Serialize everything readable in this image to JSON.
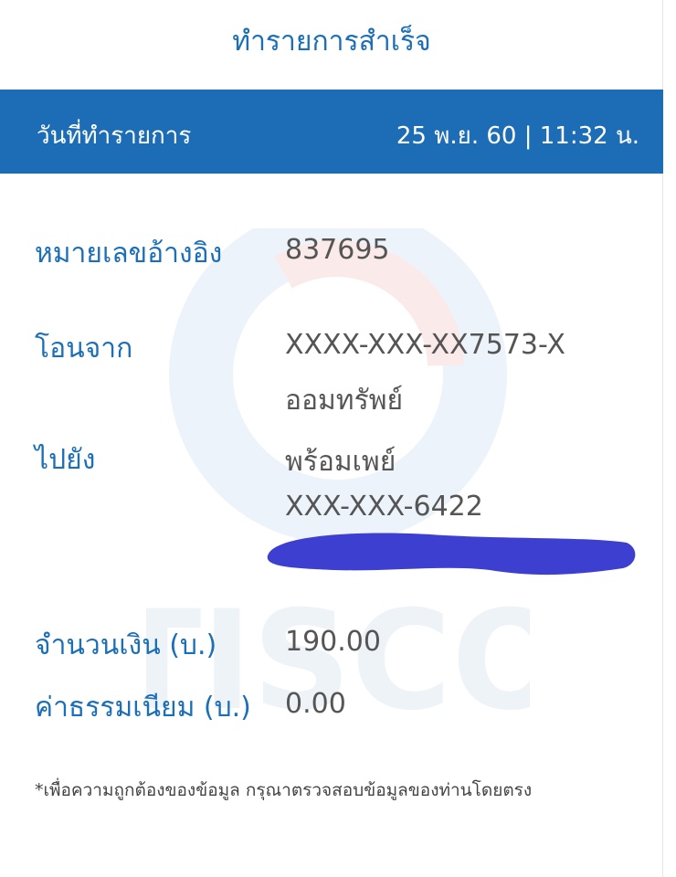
{
  "header": {
    "title": "ทำรายการสำเร็จ"
  },
  "date_bar": {
    "label": "วันที่ทำรายการ",
    "value": "25 พ.ย. 60 | 11:32 น."
  },
  "details": {
    "reference": {
      "label": "หมายเลขอ้างอิง",
      "value": "837695"
    },
    "from": {
      "label": "โอนจาก",
      "account": "XXXX-XXX-XX7573-X",
      "account_type": "ออมทรัพย์"
    },
    "to": {
      "label": "ไปยัง",
      "service": "พร้อมเพย์",
      "number": "XXX-XXX-6422"
    },
    "amount": {
      "label": "จำนวนเงิน (บ.)",
      "value": "190.00"
    },
    "fee": {
      "label": "ค่าธรรมเนียม (บ.)",
      "value": "0.00"
    }
  },
  "footnote": "*เพื่อความถูกต้องของข้อมูล กรุณาตรวจสอบข้อมูลของท่านโดยตรง",
  "watermark_text": "TISCO",
  "colors": {
    "accent": "#1c6db5",
    "text_value": "#555555",
    "redaction": "#3d3fd0"
  }
}
